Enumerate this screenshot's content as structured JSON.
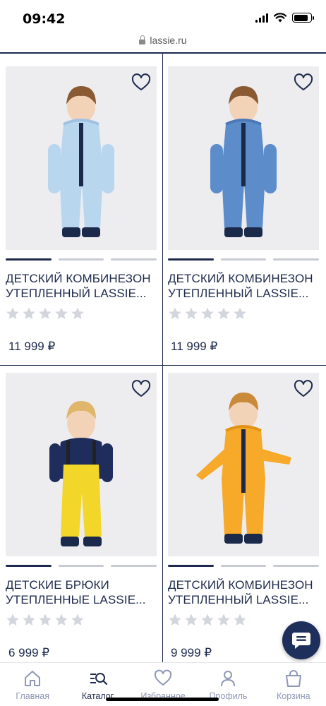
{
  "status_bar": {
    "time": "09:42",
    "battery_level": 0.85
  },
  "browser": {
    "url": "lassie.ru"
  },
  "products": [
    {
      "title_line1": "ДЕТСКИЙ КОМБИНЕЗОН",
      "title_line2": "УТЕПЛЕННЫЙ LASSIE...",
      "price": "11 999 ₽",
      "rating": 0,
      "image": "light-blue-jumpsuit",
      "colors": {
        "suit": "#b9d6ef",
        "suit_dark": "#9fc2e3"
      }
    },
    {
      "title_line1": "ДЕТСКИЙ КОМБИНЕЗОН",
      "title_line2": "УТЕПЛЕННЫЙ LASSIE...",
      "price": "11 999 ₽",
      "rating": 0,
      "image": "blue-jumpsuit",
      "colors": {
        "suit": "#5d8ccb",
        "suit_dark": "#4a78b8"
      }
    },
    {
      "title_line1": "ДЕТСКИЕ БРЮКИ",
      "title_line2": "УТЕПЛЕННЫЕ LASSIE...",
      "price": "6 999 ₽",
      "rating": 0,
      "image": "yellow-pants",
      "colors": {
        "suit": "#f2d62a",
        "suit_dark": "#d9bd15"
      }
    },
    {
      "title_line1": "ДЕТСКИЙ КОМБИНЕЗОН",
      "title_line2": "УТЕПЛЕННЫЙ LASSIE...",
      "price": "9 999 ₽",
      "rating": 0,
      "image": "orange-jumpsuit",
      "colors": {
        "suit": "#f7a92a",
        "suit_dark": "#e29316"
      }
    }
  ],
  "tab_bar": {
    "items": [
      {
        "label": "Главная",
        "icon": "home-icon"
      },
      {
        "label": "Каталог",
        "icon": "catalog-search-icon",
        "active": true
      },
      {
        "label": "Избранное",
        "icon": "heart-icon"
      },
      {
        "label": "Профиль",
        "icon": "user-icon"
      },
      {
        "label": "Корзина",
        "icon": "shopping-bag-icon"
      }
    ]
  },
  "theme": {
    "navy": "#1d2a4d",
    "muted": "#8e98b6",
    "star": "#d3d6dd",
    "image_bg": "#ededf0"
  }
}
